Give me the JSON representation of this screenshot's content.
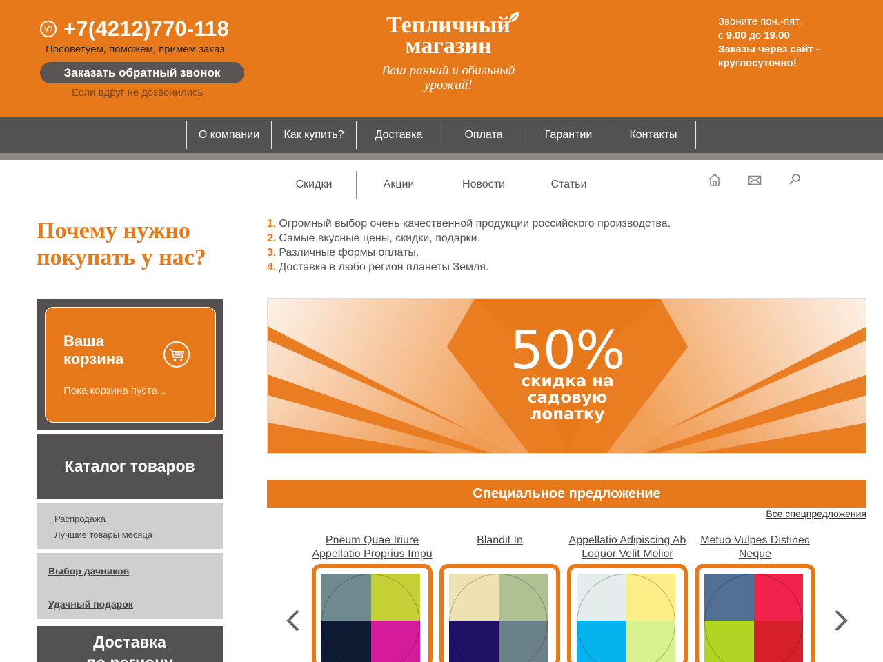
{
  "header": {
    "phone": "+7(4212)770-118",
    "advice": "Посоветуем, поможем, примем заказ",
    "callback_button": "Заказать обратный звонок",
    "callback_note": "Если вдруг не дозвонились",
    "logo_line1": "Тепличный",
    "logo_line2": "магазин",
    "tagline_line1": "Ваш ранний и обильный",
    "tagline_line2": "урожай!",
    "hours_line1": "Звоните пон.-пят.",
    "hours_from": "с ",
    "hours_start": "9.00",
    "hours_mid": " до ",
    "hours_end": "19.00",
    "orders_line1": "Заказы через сайт -",
    "orders_line2": "круглосуточно!"
  },
  "main_nav": [
    {
      "label": "О компании"
    },
    {
      "label": "Как купить?"
    },
    {
      "label": "Доставка"
    },
    {
      "label": "Оплата"
    },
    {
      "label": "Гарантии"
    },
    {
      "label": "Контакты"
    }
  ],
  "sub_nav": [
    {
      "label": "Скидки"
    },
    {
      "label": "Акции"
    },
    {
      "label": "Новости"
    },
    {
      "label": "Статьи"
    }
  ],
  "tool_icons": [
    "home-icon",
    "mail-icon",
    "search-icon"
  ],
  "sidebar": {
    "why_line1": "Почему нужно",
    "why_line2": "покупать у нас?",
    "cart_title_line1": "Ваша",
    "cart_title_line2": "корзина",
    "cart_empty": "Пока корзина пуста...",
    "catalog_title": "Каталог товаров",
    "sale_links": [
      "Распродажа",
      "Лучшие товары месяца"
    ],
    "pick_links": [
      "Выбор дачников",
      "Удачный подарок"
    ],
    "delivery_title_line1": "Доставка",
    "delivery_title_line2": "по региону"
  },
  "benefits": [
    {
      "num": "1.",
      "text": "Огромный выбор очень качественной продукции российского производства."
    },
    {
      "num": "2.",
      "text": "Самые вкусные цены, скидки, подарки."
    },
    {
      "num": "3.",
      "text": "Различные формы оплаты."
    },
    {
      "num": "4.",
      "text": "Доставка в любо регион планеты Земля."
    }
  ],
  "banner": {
    "percent": "50%",
    "line1": "скидка на",
    "line2": "садовую",
    "line3": "лопатку"
  },
  "special": {
    "title": "Специальное предложение",
    "all_link": "Все спецпредложения"
  },
  "products": [
    {
      "name_line1": "Pneum Quae Iriure",
      "name_line2": "Appellatio Proprius Impu",
      "colors": [
        "#6f8a8e",
        "#c4d035",
        "#0e1b33",
        "#d41c9b"
      ]
    },
    {
      "name_line1": "Blandit In",
      "name_line2": "",
      "colors": [
        "#ece3b1",
        "#adc192",
        "#1f1066",
        "#6b8189"
      ]
    },
    {
      "name_line1": "Appellatio Adipiscing Ab",
      "name_line2": "Loquor Velit Molior",
      "colors": [
        "#e5eced",
        "#fdef88",
        "#07b3ef",
        "#d8f292"
      ]
    },
    {
      "name_line1": "Metuo Vulpes Distinec",
      "name_line2": "Neque",
      "colors": [
        "#526f95",
        "#f1214c",
        "#b1d422",
        "#d71f2a"
      ]
    }
  ],
  "colors": {
    "accent": "#e8791a",
    "dark": "#555150"
  }
}
